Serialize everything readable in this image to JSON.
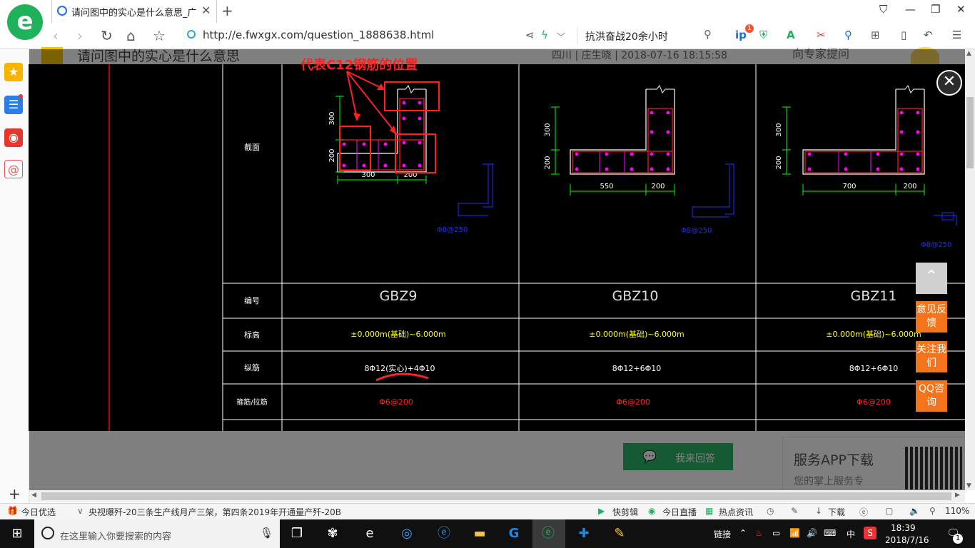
{
  "browser": {
    "tab_title": "请问图中的实心是什么意思_广联",
    "url": "http://e.fwxgx.com/question_1888638.html",
    "search_value": "抗洪奋战20余小时",
    "notification_count": "1"
  },
  "page": {
    "question_title": "请问图中的实心是什么意思",
    "meta": "四川 | 庄生晓 | 2018-07-16 18:15:58",
    "side_link": "向专家提问",
    "answer_button": "我来回答",
    "app_title": "服务APP下载",
    "app_subtitle": "您的掌上服务专"
  },
  "drawing": {
    "annotation": "代表C12钢筋的位置",
    "row_labels": [
      "截面",
      "编号",
      "标高",
      "纵筋",
      "箍筋/拉筋"
    ],
    "columns": [
      {
        "code": "GBZ9",
        "elevation": "±0.000m(基础)~6.000m",
        "rebar": "8Φ12(实心)+4Φ10",
        "stirrup": "Φ6@200",
        "dims": [
          "300",
          "200",
          "300",
          "200"
        ],
        "tie": "Φ8@250"
      },
      {
        "code": "GBZ10",
        "elevation": "±0.000m(基础)~6.000m",
        "rebar": "8Φ12+6Φ10",
        "stirrup": "Φ6@200",
        "dims": [
          "300",
          "200",
          "550",
          "200"
        ],
        "tie": "Φ8@250"
      },
      {
        "code": "GBZ11",
        "elevation": "±0.000m(基础)~6.000m",
        "rebar": "8Φ12+6Φ10",
        "stirrup": "Φ6@200",
        "dims": [
          "300",
          "200",
          "700",
          "200"
        ],
        "tie": "Φ8@250"
      }
    ]
  },
  "side_tools": {
    "feedback": "意见反馈",
    "follow": "关注我们",
    "qq": "QQ咨询"
  },
  "status_bar": {
    "today": "今日优选",
    "news": "央视曝歼-20三条生产线月产三架，第四条2019年开通量产歼-20B",
    "quick_cut": "快剪辑",
    "live": "今日直播",
    "hot": "热点资讯",
    "download": "下载",
    "zoom": "110%"
  },
  "taskbar": {
    "search_placeholder": "在这里输入你要搜索的内容",
    "link_label": "链接",
    "ime": "中",
    "time": "18:39",
    "date": "2018/7/16",
    "notifications": "1"
  },
  "colors": {
    "cad_bg": "#000000",
    "cad_grid": "#ffffff",
    "cad_dim": "#00ff00",
    "cad_yellow": "#ffff00",
    "cad_red": "#ff0000",
    "cad_blue": "#2030ff",
    "cad_magenta": "#ff00ff",
    "annotation": "#ff2020",
    "accent_orange": "#f5731a",
    "answer_green": "#2db567"
  }
}
